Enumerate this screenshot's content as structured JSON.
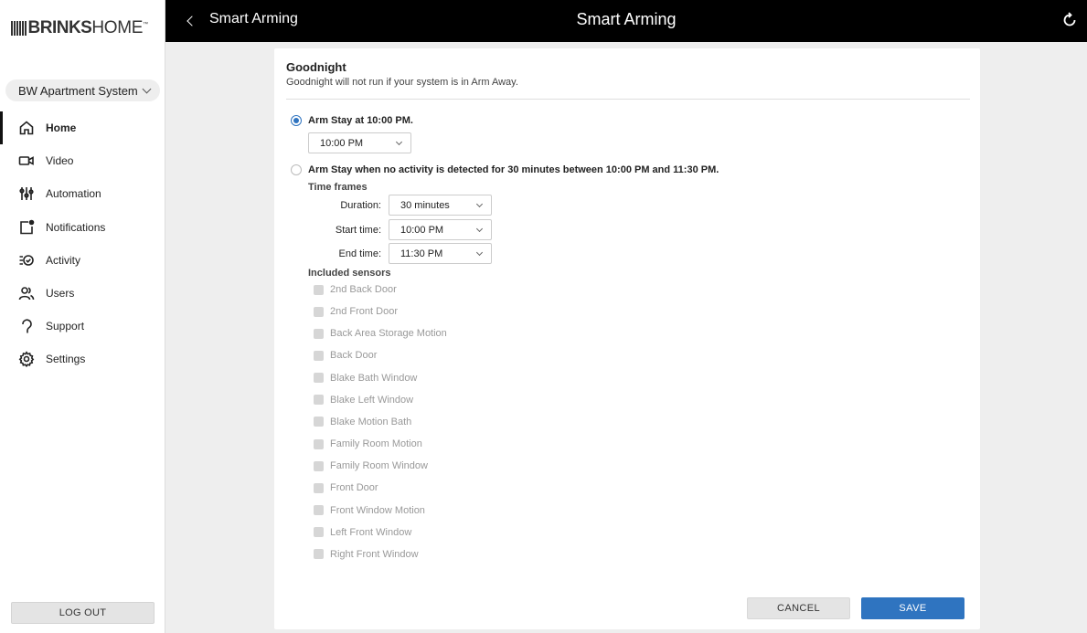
{
  "app": {
    "brand_bold": "BRINKS",
    "brand_light": "HOME",
    "trademark": "™"
  },
  "sidebar": {
    "system_selector": "BW Apartment System",
    "items": [
      {
        "label": "Home",
        "icon": "home-icon",
        "active": true
      },
      {
        "label": "Video",
        "icon": "video-camera-icon",
        "active": false
      },
      {
        "label": "Automation",
        "icon": "sliders-icon",
        "active": false
      },
      {
        "label": "Notifications",
        "icon": "notification-icon",
        "active": false
      },
      {
        "label": "Activity",
        "icon": "activity-list-icon",
        "active": false
      },
      {
        "label": "Users",
        "icon": "users-icon",
        "active": false
      },
      {
        "label": "Support",
        "icon": "support-icon",
        "active": false
      },
      {
        "label": "Settings",
        "icon": "gear-icon",
        "active": false
      }
    ],
    "logout_label": "LOG OUT"
  },
  "header": {
    "back_label": "Smart Arming",
    "title": "Smart Arming",
    "refresh_icon": "refresh-icon"
  },
  "card": {
    "title": "Goodnight",
    "subtitle": "Goodnight will not run if your system is in Arm Away.",
    "option1": {
      "label": "Arm Stay at 10:00 PM.",
      "selected": true,
      "time_value": "10:00 PM"
    },
    "option2": {
      "label": "Arm Stay when no activity is detected for 30 minutes between 10:00 PM and 11:30 PM.",
      "selected": false,
      "time_frames_label": "Time frames",
      "duration_label": "Duration:",
      "duration_value": "30 minutes",
      "start_label": "Start time:",
      "start_value": "10:00 PM",
      "end_label": "End time:",
      "end_value": "11:30 PM",
      "sensors_label": "Included sensors",
      "sensors": [
        "2nd Back Door",
        "2nd Front Door",
        "Back Area Storage Motion",
        "Back Door",
        "Blake Bath Window",
        "Blake Left Window",
        "Blake Motion Bath",
        "Family Room Motion",
        "Family Room Window",
        "Front Door",
        "Front Window Motion",
        "Left Front Window",
        "Right Front Window"
      ]
    },
    "cancel_label": "CANCEL",
    "save_label": "SAVE"
  },
  "colors": {
    "accent": "#2f74c0",
    "header_bg": "#000000",
    "page_bg": "#eeeeee"
  }
}
